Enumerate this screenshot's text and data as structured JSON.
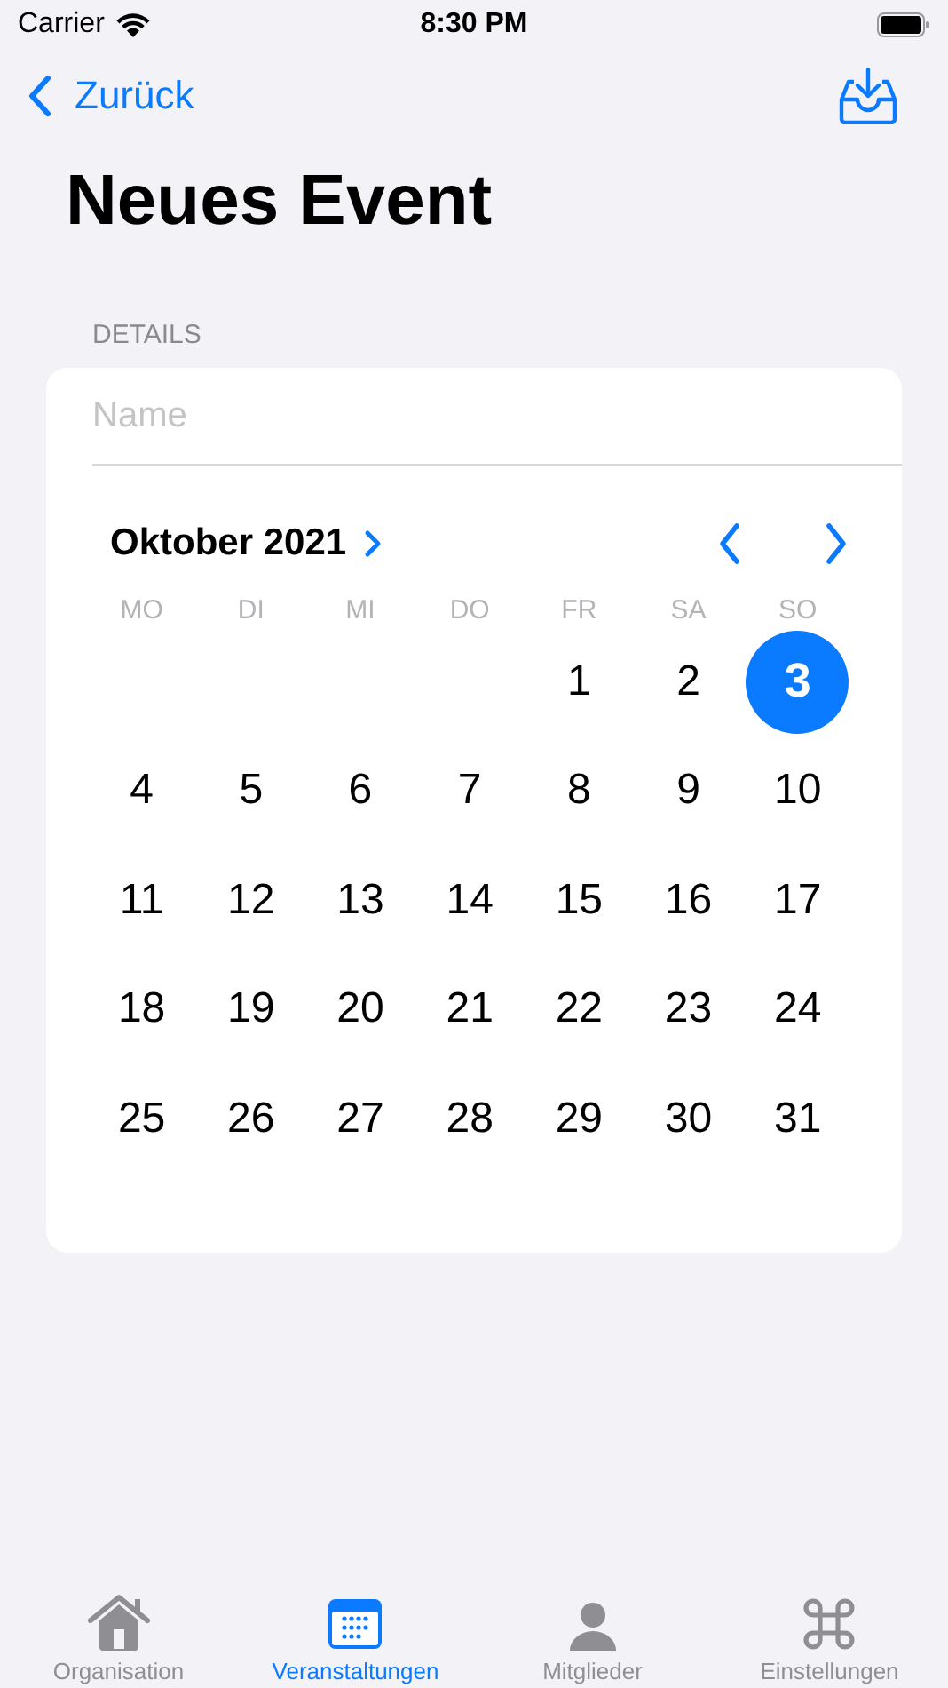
{
  "status_bar": {
    "carrier": "Carrier",
    "time": "8:30 PM"
  },
  "nav": {
    "back": "Zurück"
  },
  "title": "Neues Event",
  "section": "DETAILS",
  "name_field": {
    "placeholder": "Name"
  },
  "calendar": {
    "month": "Oktober 2021",
    "weekdays": [
      "MO",
      "DI",
      "MI",
      "DO",
      "FR",
      "SA",
      "SO"
    ],
    "weeks": [
      [
        {
          "label": "1",
          "selected": false
        },
        {
          "label": "2",
          "selected": false
        },
        {
          "label": "3",
          "selected": true
        }
      ],
      [
        {
          "label": "4",
          "selected": false
        },
        {
          "label": "5",
          "selected": false
        },
        {
          "label": "6",
          "selected": false
        },
        {
          "label": "7",
          "selected": false
        },
        {
          "label": "8",
          "selected": false
        },
        {
          "label": "9",
          "selected": false
        },
        {
          "label": "10",
          "selected": false
        }
      ],
      [
        {
          "label": "11",
          "selected": false
        },
        {
          "label": "12",
          "selected": false
        },
        {
          "label": "13",
          "selected": false
        },
        {
          "label": "14",
          "selected": false
        },
        {
          "label": "15",
          "selected": false
        },
        {
          "label": "16",
          "selected": false
        },
        {
          "label": "17",
          "selected": false
        }
      ],
      [
        {
          "label": "18",
          "selected": false
        },
        {
          "label": "19",
          "selected": false
        },
        {
          "label": "20",
          "selected": false
        },
        {
          "label": "21",
          "selected": false
        },
        {
          "label": "22",
          "selected": false
        },
        {
          "label": "23",
          "selected": false
        },
        {
          "label": "24",
          "selected": false
        }
      ],
      [
        {
          "label": "25",
          "selected": false
        },
        {
          "label": "26",
          "selected": false
        },
        {
          "label": "27",
          "selected": false
        },
        {
          "label": "28",
          "selected": false
        },
        {
          "label": "29",
          "selected": false
        },
        {
          "label": "30",
          "selected": false
        },
        {
          "label": "31",
          "selected": false
        }
      ]
    ]
  },
  "tabs": [
    {
      "label": "Organisation",
      "kind": "house",
      "selected": false
    },
    {
      "label": "Veranstaltungen",
      "kind": "calendar",
      "selected": true
    },
    {
      "label": "Mitglieder",
      "kind": "person",
      "selected": false
    },
    {
      "label": "Einstellungen",
      "kind": "command",
      "selected": false
    }
  ]
}
